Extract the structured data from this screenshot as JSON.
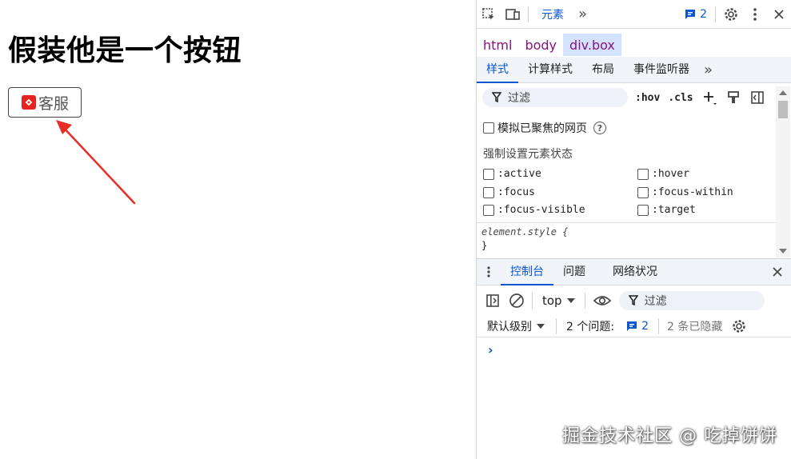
{
  "page": {
    "title": "假装他是一个按钮",
    "fake_button": {
      "label": "客服",
      "brand_color": "#e52420"
    },
    "arrow_color": "#e62e25"
  },
  "devtools": {
    "topbar": {
      "active_tab": "元素",
      "issues_count": "2",
      "icons": [
        "inspect-icon",
        "device-toggle-icon",
        "more-tabs-icon",
        "settings-icon",
        "kebab-icon",
        "close-icon"
      ]
    },
    "breadcrumbs": [
      "html",
      "body",
      "div.box"
    ],
    "subtabs": [
      "样式",
      "计算样式",
      "布局",
      "事件监听器"
    ],
    "styles": {
      "filter_placeholder": "过滤",
      "hov_label": ":hov",
      "cls_label": ".cls",
      "emulate_focus_label": "模拟已聚焦的网页",
      "force_state_label": "强制设置元素状态",
      "states": [
        ":active",
        ":hover",
        ":focus",
        ":focus-within",
        ":focus-visible",
        ":target"
      ],
      "element_style_selector": "element.style {",
      "element_style_close": "}"
    },
    "drawer": {
      "tabs": [
        "控制台",
        "问题",
        "网络状况"
      ],
      "context": "top",
      "filter_placeholder": "过滤",
      "default_level": "默认级别",
      "issues_label": "2 个问题:",
      "issues_n": "2",
      "hidden_label": "2 条已隐藏",
      "prompt": "›"
    },
    "accent_color": "#0b57d0"
  },
  "watermark": "掘金技术社区 @ 吃掉饼饼"
}
